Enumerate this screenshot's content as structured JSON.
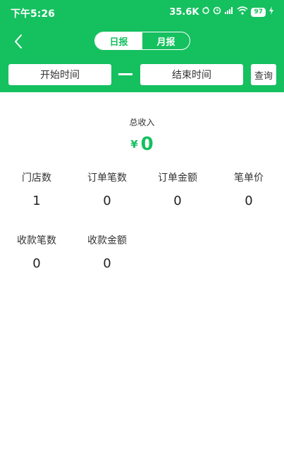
{
  "status_bar": {
    "time": "下午5:26",
    "network_speed": "35.6K",
    "battery": "97"
  },
  "nav": {
    "tabs": [
      {
        "label": "日报",
        "active": true
      },
      {
        "label": "月报",
        "active": false
      }
    ]
  },
  "filter": {
    "start_label": "开始时间",
    "end_label": "结束时间",
    "query_label": "查询"
  },
  "summary": {
    "total_label": "总收入",
    "currency": "¥",
    "total_value": "0"
  },
  "stats": [
    {
      "label": "门店数",
      "value": "1"
    },
    {
      "label": "订单笔数",
      "value": "0"
    },
    {
      "label": "订单金额",
      "value": "0"
    },
    {
      "label": "笔单价",
      "value": "0"
    },
    {
      "label": "收款笔数",
      "value": "0"
    },
    {
      "label": "收款金额",
      "value": "0"
    }
  ],
  "colors": {
    "brand": "#15c05f",
    "text": "#333333"
  }
}
